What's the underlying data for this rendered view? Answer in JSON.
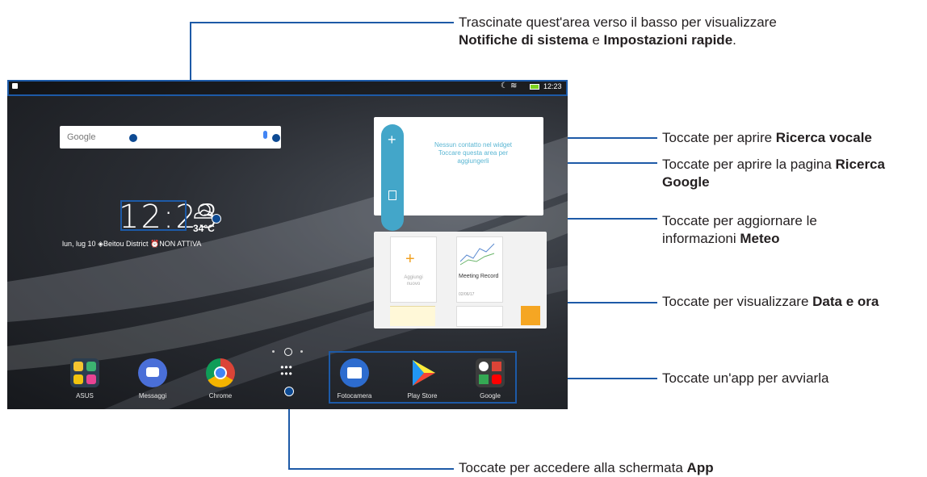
{
  "callouts": {
    "top_line1": "Trascinate quest'area verso il basso per visualizzare",
    "top_b1": "Notifiche di sistema",
    "top_mid": " e ",
    "top_b2": "Impostazioni rapide",
    "top_end": ".",
    "voice_pre": "Toccate per aprire ",
    "voice_b": "Ricerca vocale",
    "google_pre": "Toccate per aprire la pagina ",
    "google_b1": "Ricerca",
    "google_b2": "Google",
    "weather_line1": "Toccate per aggiornare le",
    "weather_pre": "informazioni ",
    "weather_b": "Meteo",
    "date_pre": "Toccate per visualizzare ",
    "date_b": "Data e ora",
    "app_launch": "Toccate un'app per avviarla",
    "apps_pre": "Toccate per accedere alla schermata ",
    "apps_b": "App"
  },
  "statusbar": {
    "time": "12:23"
  },
  "search": {
    "placeholder": "Google"
  },
  "clock": {
    "time": "12:23",
    "temp": "34°C",
    "date": "lun, lug 10",
    "location": "Beitou District",
    "alarm": "NON ATTIVA"
  },
  "contacts_widget": {
    "line1": "Nessun contatto nel widget",
    "line2": "Toccare questa area per",
    "line3": "aggiungerli"
  },
  "memo_widget": {
    "add": "Aggiungi",
    "new": "nuovo",
    "meeting": "Meeting Record",
    "date": "02/06/17"
  },
  "dock": [
    {
      "label": "ASUS"
    },
    {
      "label": "Messaggi"
    },
    {
      "label": "Chrome"
    },
    {
      "label": ""
    },
    {
      "label": "Fotocamera"
    },
    {
      "label": "Play Store"
    },
    {
      "label": "Google"
    }
  ]
}
